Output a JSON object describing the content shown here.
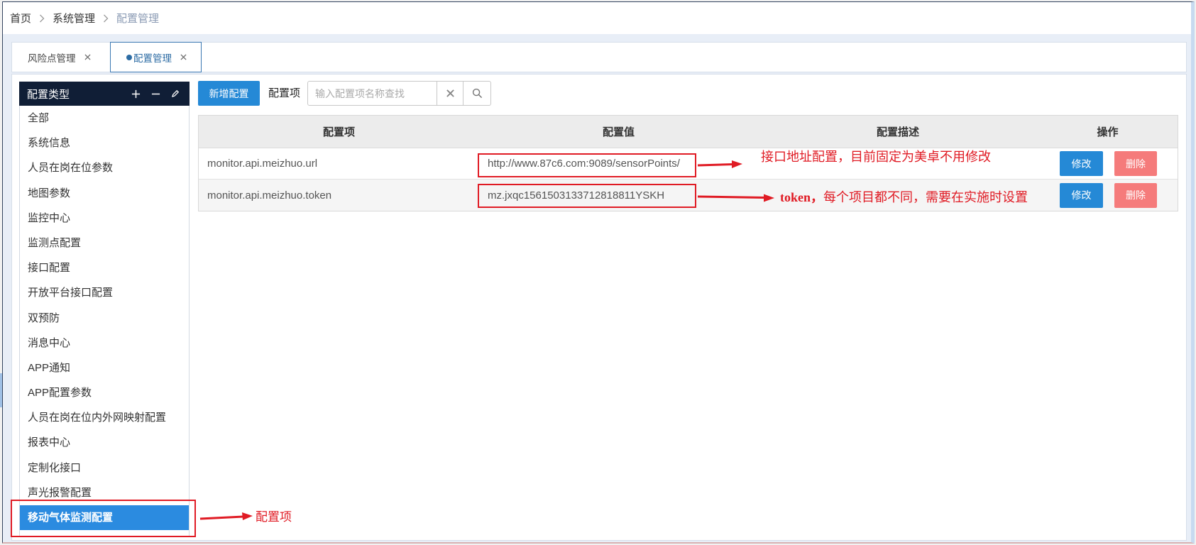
{
  "breadcrumb": {
    "items": [
      "首页",
      "系统管理",
      "配置管理"
    ],
    "separator_icon": "chevron-right-icon"
  },
  "tabs": [
    {
      "label": "风险点管理",
      "active": false,
      "close_icon": "close-icon"
    },
    {
      "label": "配置管理",
      "active": true,
      "indicator_icon": "active-dot-icon",
      "close_icon": "close-icon"
    }
  ],
  "sidebar": {
    "title": "配置类型",
    "header_actions": [
      {
        "icon": "plus-icon"
      },
      {
        "icon": "minus-icon"
      },
      {
        "icon": "pencil-icon"
      }
    ],
    "items": [
      {
        "label": "全部"
      },
      {
        "label": "系统信息"
      },
      {
        "label": "人员在岗在位参数"
      },
      {
        "label": "地图参数"
      },
      {
        "label": "监控中心"
      },
      {
        "label": "监测点配置"
      },
      {
        "label": "接口配置"
      },
      {
        "label": "开放平台接口配置"
      },
      {
        "label": "双预防"
      },
      {
        "label": "消息中心"
      },
      {
        "label": "APP通知"
      },
      {
        "label": "APP配置参数"
      },
      {
        "label": "人员在岗在位内外网映射配置"
      },
      {
        "label": "报表中心"
      },
      {
        "label": "定制化接口"
      },
      {
        "label": "声光报警配置"
      },
      {
        "label": "移动气体监测配置",
        "selected": true
      }
    ]
  },
  "toolbar": {
    "add_label": "新增配置",
    "search_label": "配置项",
    "search_placeholder": "输入配置项名称查找",
    "clear_icon": "clear-icon",
    "search_icon": "search-icon"
  },
  "table": {
    "columns": [
      "配置项",
      "配置值",
      "配置描述",
      "操作"
    ],
    "rows": [
      {
        "key": "monitor.api.meizhuo.url",
        "value": "http://www.87c6.com:9089/sensorPoints/",
        "edit_label": "修改",
        "delete_label": "删除"
      },
      {
        "key": "monitor.api.meizhuo.token",
        "value": "mz.jxqc1561503133712818811YSKH",
        "edit_label": "修改",
        "delete_label": "删除"
      }
    ]
  },
  "annotations": {
    "url_note": "接口地址配置，目前固定为美卓不用修改",
    "token_note_bold": "token，",
    "token_note": "每个项目都不同，需要在实施时设置",
    "sidebar_note": "配置项"
  },
  "colors": {
    "nav_dark": "#101e36",
    "primary": "#2589d6",
    "selected": "#2b8be0",
    "danger": "#f57b7b",
    "annotation_red": "#e01b24",
    "breadcrumb_current": "#8b9bb4",
    "active_tab": "#2d6ca4",
    "table_header": "#ececec"
  }
}
